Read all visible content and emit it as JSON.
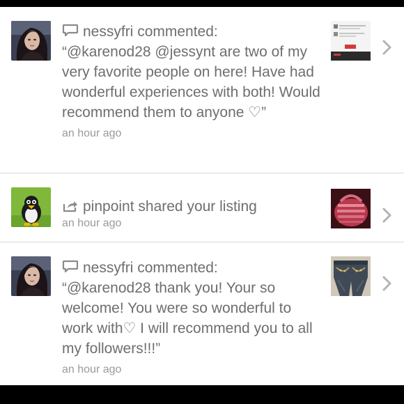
{
  "items": [
    {
      "user": "nessyfri",
      "action": "commented:",
      "comment": "“@karenod28 @jessynt are two of my very favorite people on here! Have had wonderful experiences with both! Would recommend them to anyone ♡”",
      "time": "an hour ago",
      "icon": "comment-icon"
    },
    {
      "user": "pinpoint",
      "action": "shared your listing",
      "time": "an hour ago",
      "icon": "share-icon"
    },
    {
      "user": "nessyfri",
      "action": "commented:",
      "comment": "“@karenod28 thank you! Your so welcome! You were so wonderful to work with♡ I will recommend you to all my followers!!!”",
      "time": "an hour ago",
      "icon": "comment-icon"
    }
  ],
  "colors": {
    "text": "#6e6e6e",
    "timestamp": "#9a9a9a",
    "divider": "#d9d9d9",
    "chevron": "#b3b3b3"
  }
}
